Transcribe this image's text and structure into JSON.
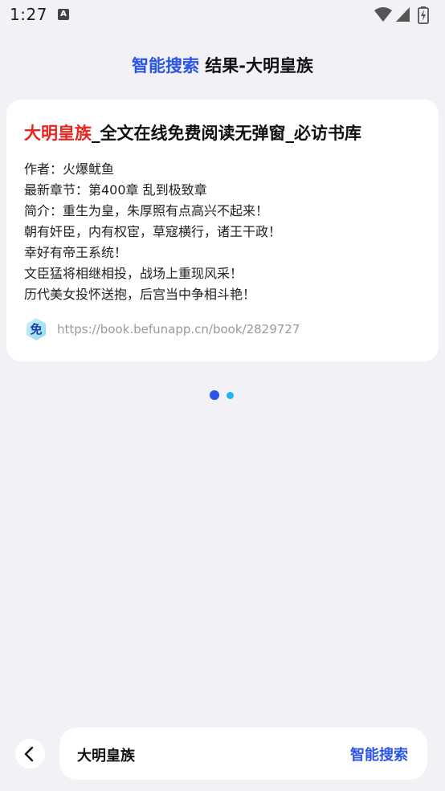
{
  "status_bar": {
    "time": "1:27",
    "notification_icon": "a-notification-icon",
    "wifi_icon": "wifi-icon",
    "signal_icon": "cell-signal-icon",
    "battery_icon": "battery-charging-icon"
  },
  "header": {
    "accent": "智能搜索",
    "rest": " 结果-大明皇族"
  },
  "result": {
    "title_highlight": "大明皇族",
    "title_rest": "_全文在线免费阅读无弹窗_必访书库",
    "author": "作者：火爆鱿鱼",
    "latest_chapter": "最新章节：第400章 乱到极致章",
    "intro_lines": [
      "简介：重生为皇，朱厚照有点高兴不起来！",
      "朝有奸臣，内有权宦，草寇横行，诸王干政！",
      "幸好有帝王系统！",
      "文臣猛将相继相投，战场上重现风采！",
      "历代美女投怀送抱，后宫当中争相斗艳！"
    ],
    "source_badge": "免",
    "source_url": "https://book.befunapp.cn/book/2829727"
  },
  "pager": {
    "count": 2,
    "active_index": 0
  },
  "bottom_bar": {
    "back_icon": "chevron-left-icon",
    "query": "大明皇族",
    "action_label": "智能搜索"
  },
  "colors": {
    "background": "#F1F1F6",
    "accent": "#2B54E8",
    "highlight": "#E8241C",
    "url": "#9A9A9A",
    "dot_inactive": "#1FB6F0"
  }
}
